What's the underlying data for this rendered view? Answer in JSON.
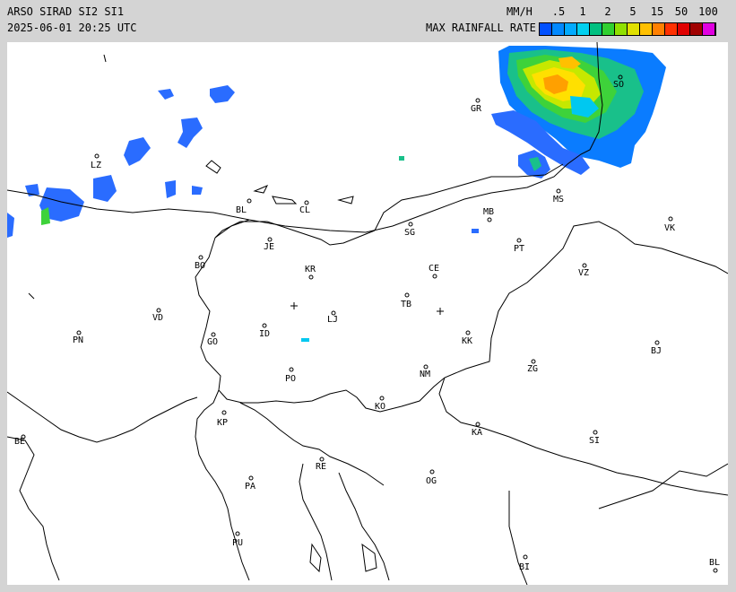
{
  "header": {
    "title": "ARSO SIRAD SI2 SI1",
    "timestamp": "2025-06-01 20:25 UTC",
    "units": "MM/H",
    "legend_title": "MAX RAINFALL RATE",
    "scale_ticks": [
      ".5",
      "1",
      "2",
      "5",
      "15",
      "50",
      "100"
    ],
    "scale_colors": [
      "#0050ff",
      "#0088ff",
      "#00aaff",
      "#00d0f0",
      "#00c080",
      "#30d030",
      "#90e000",
      "#e0e000",
      "#ffc000",
      "#ff8000",
      "#ff3000",
      "#e00000",
      "#a00000",
      "#e000e0"
    ]
  },
  "map": {
    "cities": [
      "LZ",
      "BL",
      "CL",
      "GR",
      "SO",
      "MS",
      "MB",
      "VK",
      "JE",
      "SG",
      "PT",
      "BO",
      "KR",
      "CE",
      "VZ",
      "TB",
      "LJ",
      "VD",
      "PN",
      "ID",
      "GO",
      "KK",
      "BJ",
      "PO",
      "NM",
      "ZG",
      "KO",
      "KP",
      "KA",
      "SI",
      "BE",
      "RE",
      "PA",
      "OG",
      "PU",
      "BI",
      "BL"
    ]
  }
}
